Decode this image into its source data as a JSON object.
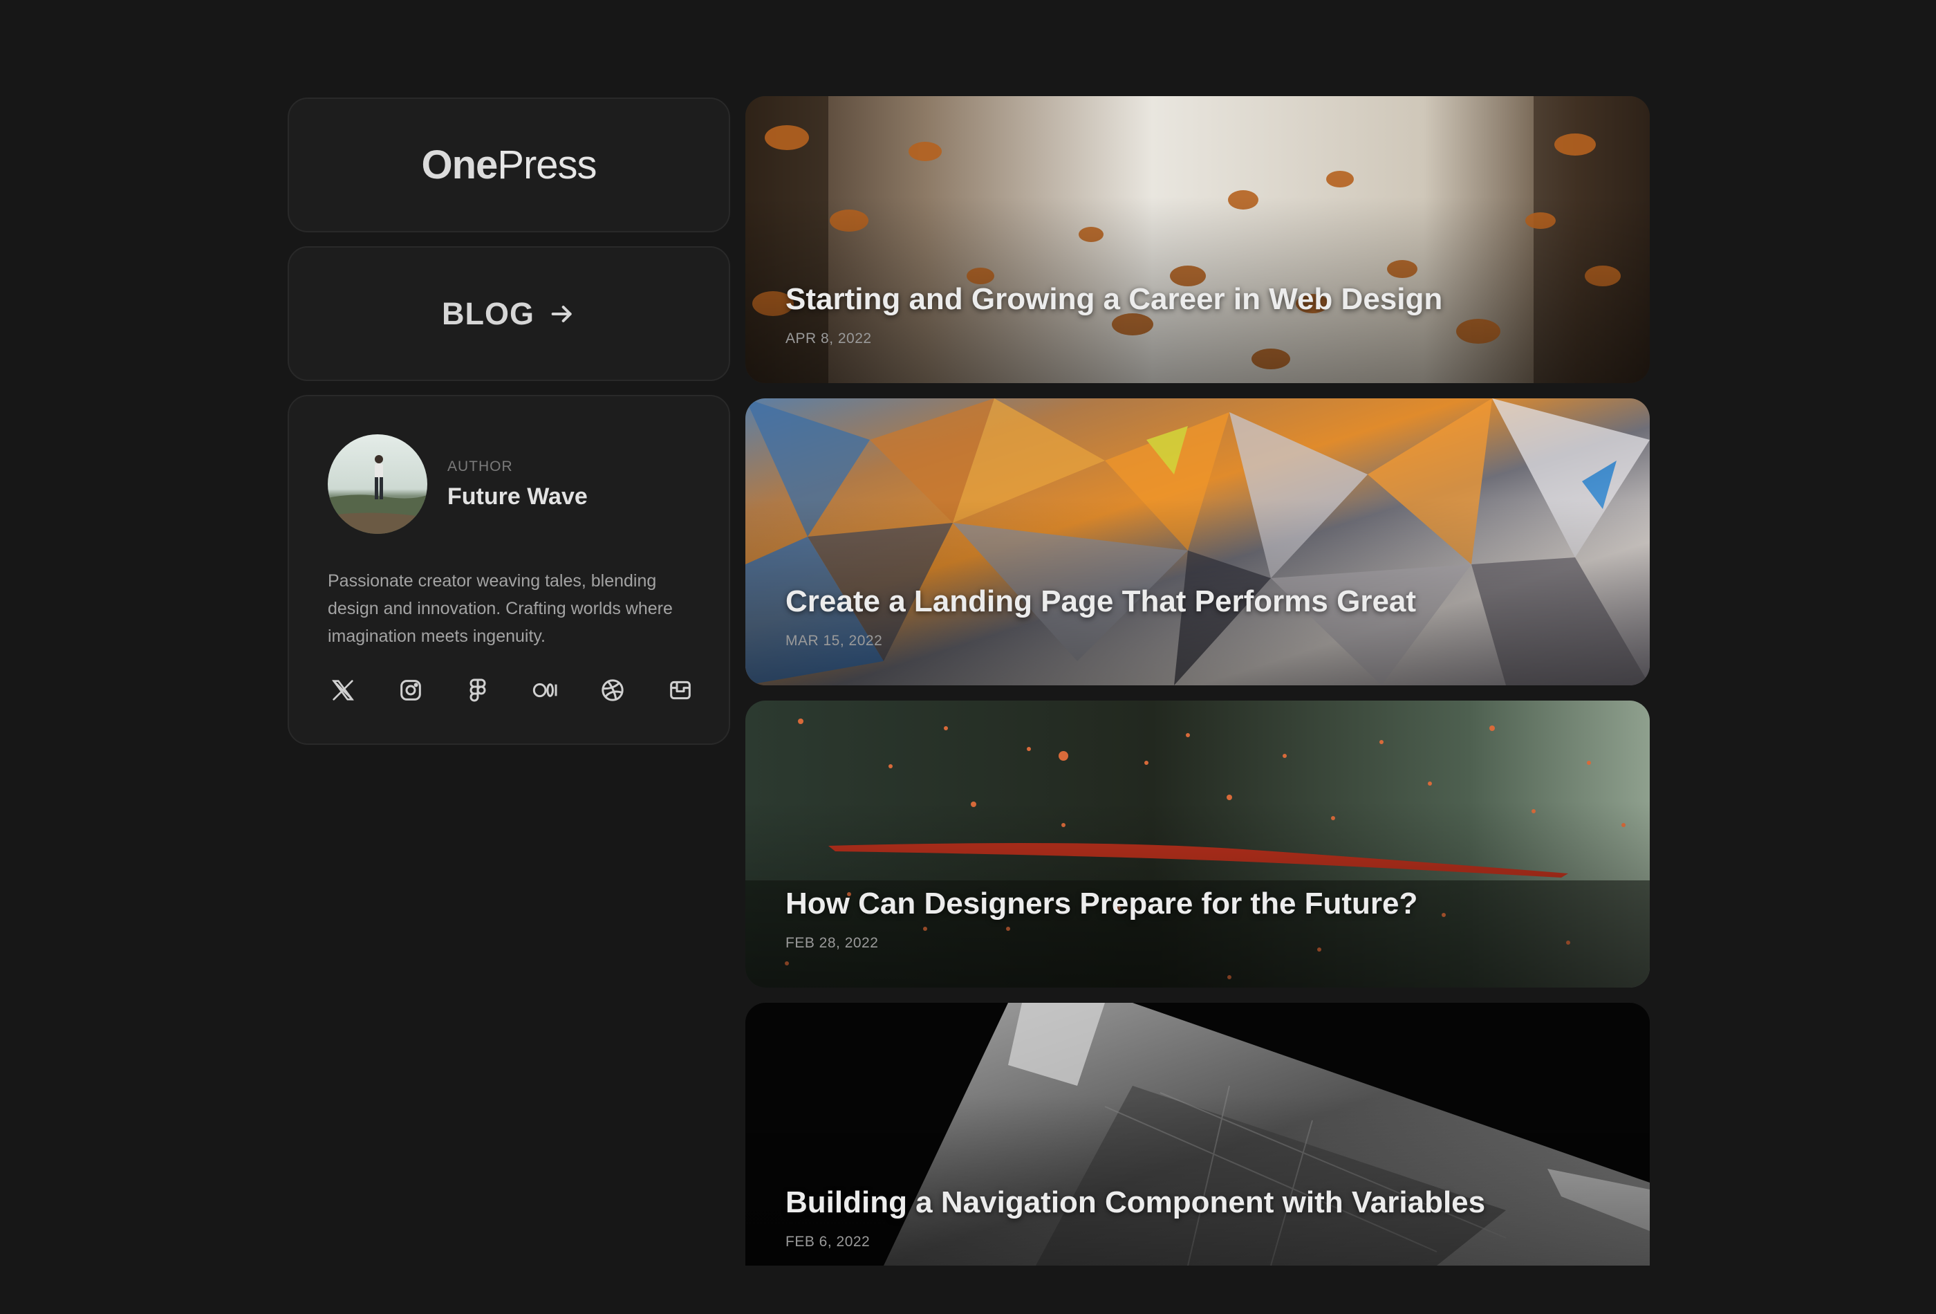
{
  "brand": {
    "logo_bold": "One",
    "logo_light": "Press"
  },
  "blog_link": {
    "label": "BLOG"
  },
  "author": {
    "label": "AUTHOR",
    "name": "Future Wave",
    "bio": "Passionate creator weaving tales, blending design and innovation. Crafting worlds where imagination meets ingenuity.",
    "socials": [
      {
        "icon": "x-icon"
      },
      {
        "icon": "instagram-icon"
      },
      {
        "icon": "figma-icon"
      },
      {
        "icon": "medium-icon"
      },
      {
        "icon": "dribbble-icon"
      },
      {
        "icon": "inbox-icon"
      }
    ]
  },
  "posts": [
    {
      "title": "Starting and Growing a Career in Web Design",
      "date": "APR 8, 2022",
      "image": "butterflies"
    },
    {
      "title": "Create a Landing Page That Performs Great",
      "date": "MAR 15, 2022",
      "image": "holographic-foil"
    },
    {
      "title": "How Can Designers Prepare for the Future?",
      "date": "FEB 28, 2022",
      "image": "sparks-forest"
    },
    {
      "title": "Building a Navigation Component with Variables",
      "date": "FEB 6, 2022",
      "image": "monochrome-abstract"
    }
  ],
  "colors": {
    "background": "#171717",
    "card": "#1d1d1d",
    "border": "#292929"
  }
}
